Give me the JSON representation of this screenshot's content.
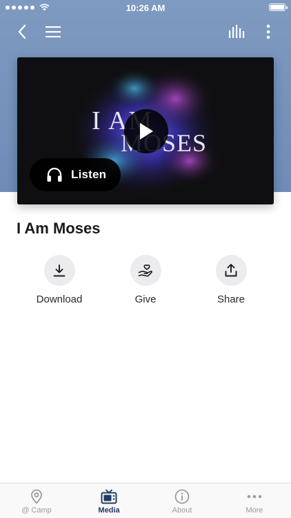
{
  "status_bar": {
    "time": "10:26 AM"
  },
  "nav": {
    "back_icon": "chevron-left-icon",
    "menu_icon": "hamburger-menu-icon",
    "audio_icon": "audio-bars-icon",
    "more_icon": "vertical-ellipsis-icon"
  },
  "media": {
    "artwork_title_line1": "I AM",
    "artwork_title_line2": "MOSES",
    "listen_label": "Listen"
  },
  "page": {
    "title": "I Am Moses"
  },
  "actions": [
    {
      "label": "Download",
      "icon": "download-icon"
    },
    {
      "label": "Give",
      "icon": "give-heart-hand-icon"
    },
    {
      "label": "Share",
      "icon": "share-icon"
    }
  ],
  "tabs": [
    {
      "label": "@ Camp",
      "icon": "location-pin-icon",
      "active": false
    },
    {
      "label": "Media",
      "icon": "tv-icon",
      "active": true
    },
    {
      "label": "About",
      "icon": "info-icon",
      "active": false
    },
    {
      "label": "More",
      "icon": "more-dots-icon",
      "active": false
    }
  ],
  "colors": {
    "header": "#7f9ac0",
    "active_tab": "#1f3a63",
    "inactive_tab": "#9b9b9b",
    "action_circle": "#ececef"
  }
}
